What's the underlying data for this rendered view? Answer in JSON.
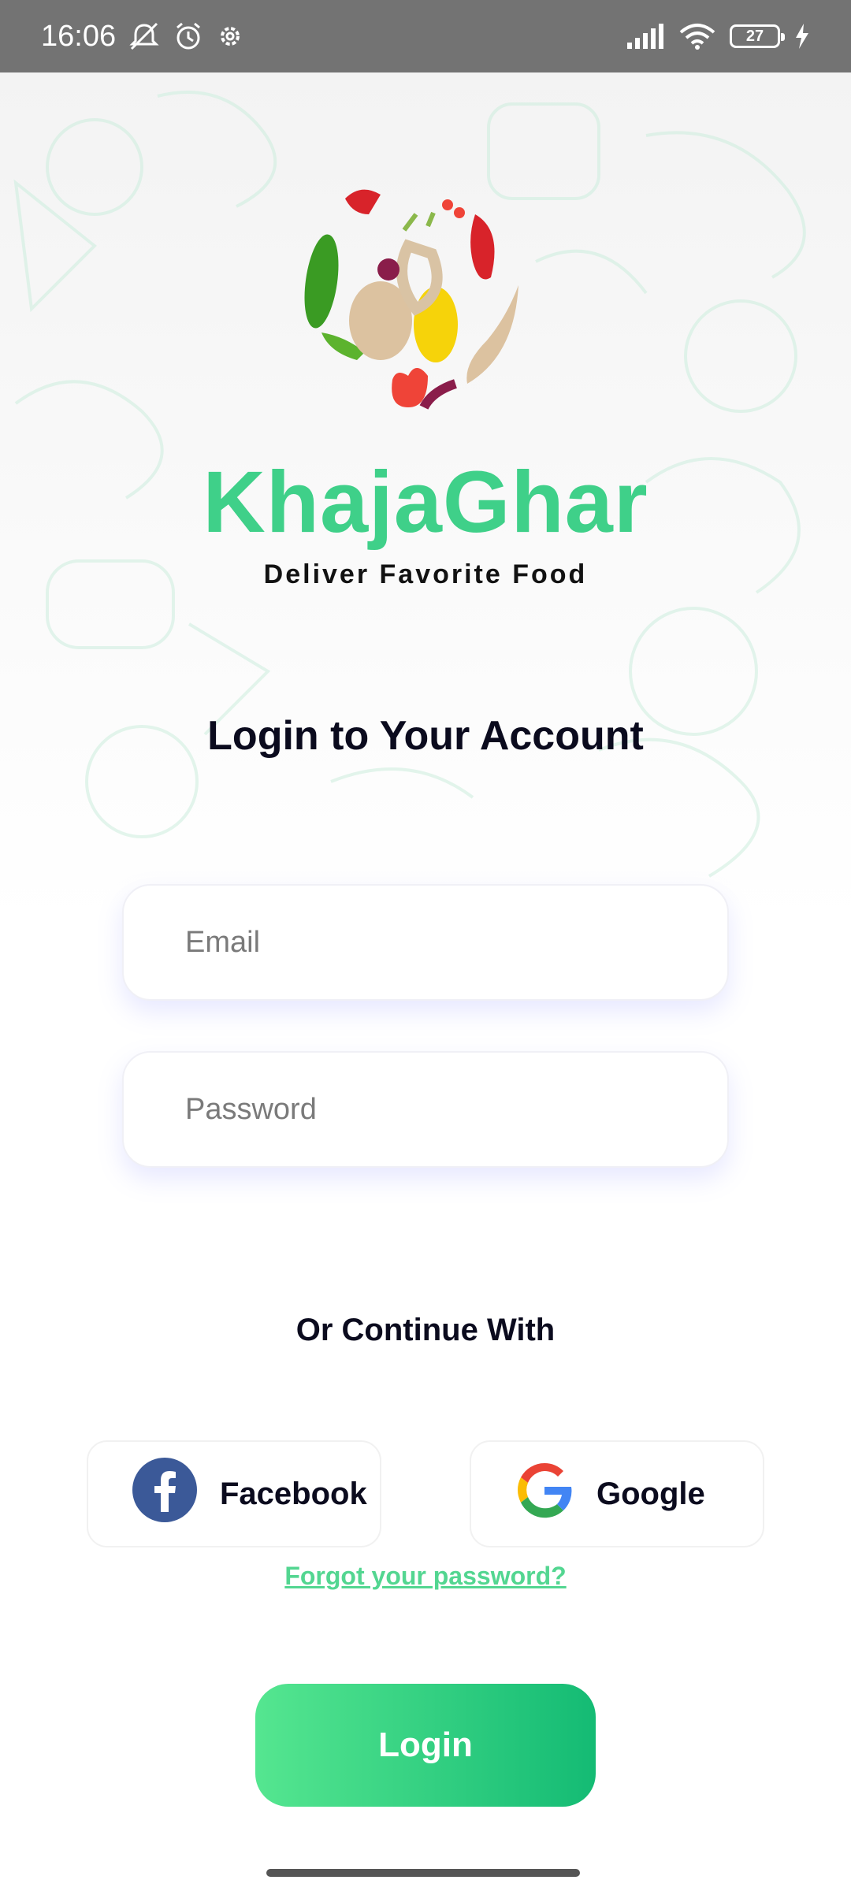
{
  "status_bar": {
    "time": "16:06",
    "icons": [
      "mute-icon",
      "alarm-icon",
      "settings-icon"
    ],
    "battery_level": "27",
    "right_icons": [
      "signal-icon",
      "wifi-icon",
      "battery-icon",
      "charging-icon"
    ]
  },
  "branding": {
    "app_name": "KhajaGhar",
    "tagline": "Deliver Favorite Food",
    "logo_icon": "food-bowl-logo"
  },
  "login": {
    "heading": "Login to Your Account",
    "email_placeholder": "Email",
    "email_value": "",
    "password_placeholder": "Password",
    "password_value": "",
    "or_text": "Or Continue With",
    "facebook_label": "Facebook",
    "google_label": "Google",
    "forgot_label": "Forgot your password?",
    "login_label": "Login"
  },
  "colors": {
    "brand_green": "#3fd089",
    "button_gradient_start": "#55e690",
    "button_gradient_end": "#14bb74",
    "link_green": "#53d691",
    "facebook_blue": "#3b5998"
  }
}
